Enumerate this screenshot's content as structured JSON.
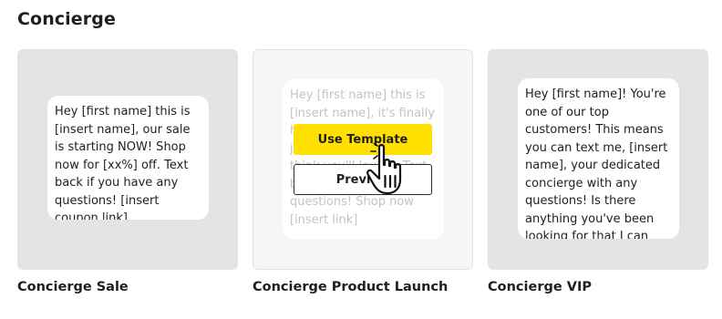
{
  "section": {
    "title": "Concierge"
  },
  "templates": [
    {
      "name": "Concierge Sale",
      "message": "Hey [first name] this is [insert name], our sale is starting NOW! Shop now for [xx%] off. Text back if you have any questions! [insert coupon link]"
    },
    {
      "name": "Concierge Product Launch",
      "message": "Hey [first name] this is [insert name], it's finally here! Our new product just dropped, and we think you'll love it. Text back if you have any questions! Shop now [insert link]",
      "actions": {
        "use_label": "Use Template",
        "preview_label": "Preview"
      }
    },
    {
      "name": "Concierge VIP",
      "message": "Hey [first name]! You're one of our top customers! This means you can text me, [insert name], your dedicated concierge with any questions! Is there anything you've been looking for that I can help you find?"
    }
  ],
  "colors": {
    "accent": "#ffe000",
    "tile": "#e3e4e3",
    "tile_hover": "#f6f6f6",
    "text": "#1f1f1f",
    "faded_text": "#c2c2c2"
  },
  "icons": {
    "cursor": "hand-pointer-icon"
  }
}
